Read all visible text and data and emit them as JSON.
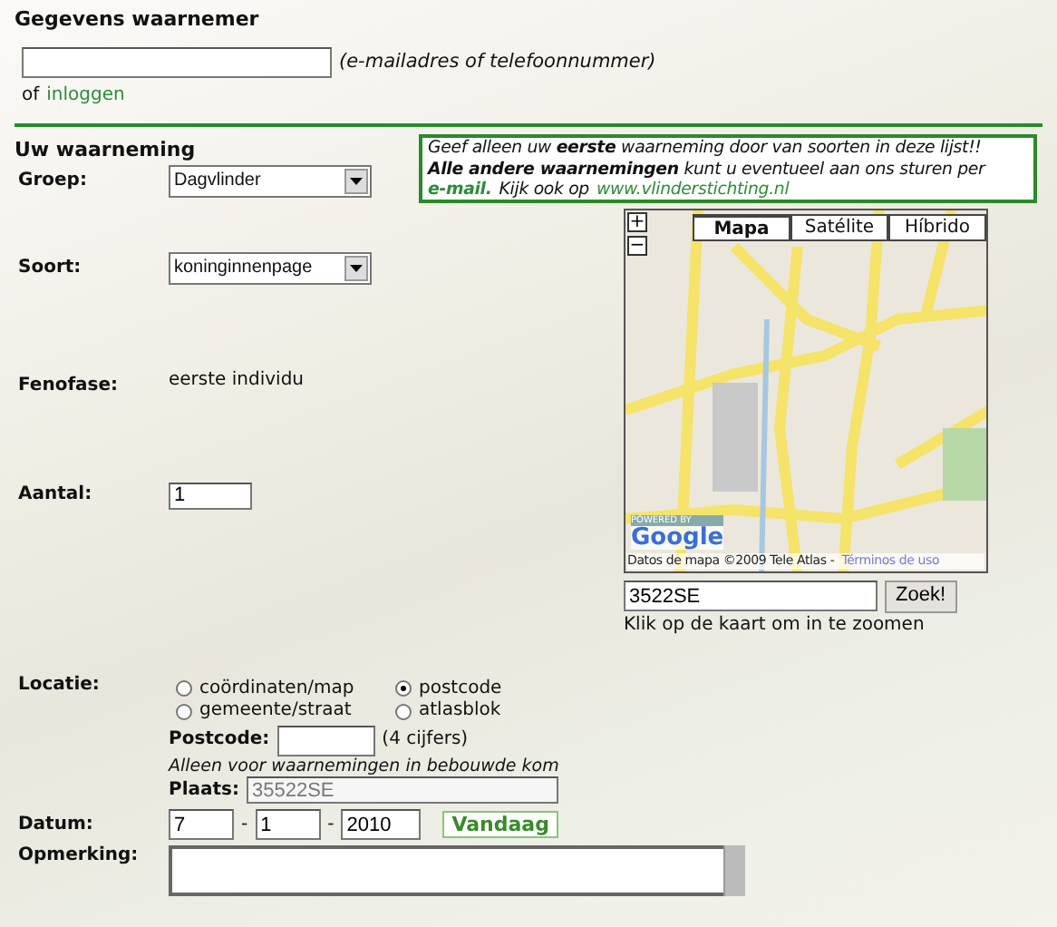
{
  "observer": {
    "title": "Gegevens waarnemer",
    "contact_hint": "(e-mailadres of telefoonnummer)",
    "login_prefix": "of",
    "login_link": "inloggen"
  },
  "observation": {
    "title": "Uw waarneming",
    "notice": {
      "line1": "Geef alleen uw **eerste** waarneming door van soorten in deze lijst!!",
      "line2": "**Alle andere waarnemingen** kunt u eventueel aan ons sturen per",
      "email_link": "e-mail.",
      "line3": "Kijk ook op",
      "site_link": "www.vlinderstichting.nl"
    },
    "fields": [
      {
        "kind": "select",
        "label": "Groep:",
        "value": "Dagvlinder"
      },
      {
        "kind": "select",
        "label": "Soort:",
        "value": "koninginnenpage"
      },
      {
        "kind": "text",
        "label": "Fenofase:",
        "value": "eerste individu"
      },
      {
        "kind": "input",
        "label": "Aantal:",
        "value": "1"
      }
    ]
  },
  "map": {
    "zoom_in": "+",
    "zoom_out": "−",
    "tabs": [
      {
        "label": "Mapa",
        "selected": true
      },
      {
        "label": "Satélite",
        "selected": false
      },
      {
        "label": "Híbrido",
        "selected": false
      }
    ],
    "powered_by": "POWERED BY",
    "logo": "Google",
    "attribution": "Datos de mapa ©2009 Tele Atlas -",
    "terms_link": "Términos de uso",
    "search_value": "3522SE",
    "search_button": "Zoek!",
    "hint": "Klik op de kaart om in te zoomen"
  },
  "location": {
    "label": "Locatie:",
    "options": [
      {
        "label": "coördinaten/map",
        "selected": false
      },
      {
        "label": "postcode",
        "selected": true
      },
      {
        "label": "gemeente/straat",
        "selected": false
      },
      {
        "label": "atlasblok",
        "selected": false
      }
    ],
    "postcode_label": "Postcode:",
    "postcode_hint": "(4 cijfers)",
    "note": "Alleen voor waarnemingen in bebouwde kom",
    "place_label": "Plaats:",
    "place_value": "35522SE",
    "place_disabled": true
  },
  "date": {
    "label": "Datum:",
    "day": "7",
    "separator1": "-",
    "month": "1",
    "separator2": "-",
    "year": "2010",
    "today_button": "Vandaag"
  },
  "remark": {
    "label": "Opmerking:"
  }
}
